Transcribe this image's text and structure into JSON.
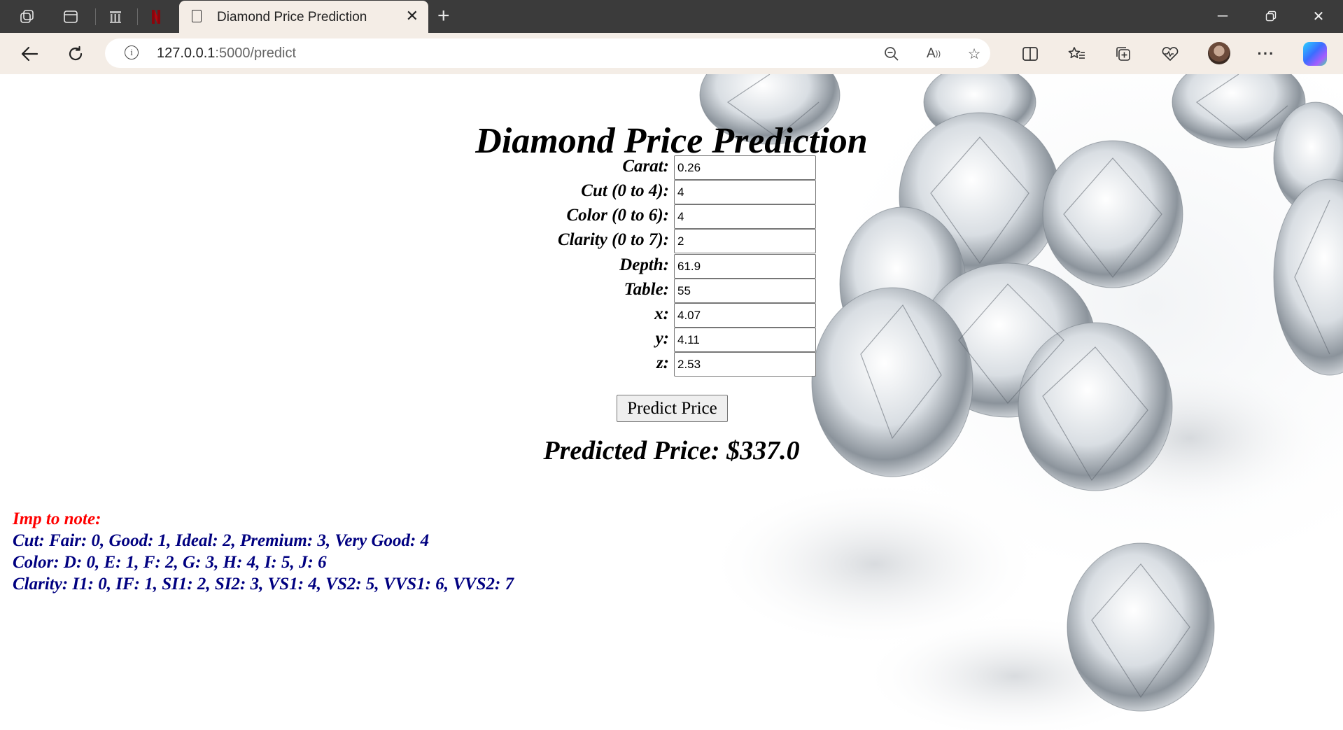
{
  "browser": {
    "tab_title": "Diamond Price Prediction",
    "url_host": "127.0.0.1",
    "url_rest": ":5000/predict",
    "new_tab_glyph": "+",
    "more_glyph": "···"
  },
  "page": {
    "title": "Diamond Price Prediction",
    "fields": [
      {
        "label": "Carat:",
        "value": "0.26"
      },
      {
        "label": "Cut (0 to 4):",
        "value": "4"
      },
      {
        "label": "Color (0 to 6):",
        "value": "4"
      },
      {
        "label": "Clarity (0 to 7):",
        "value": "2"
      },
      {
        "label": "Depth:",
        "value": "61.9"
      },
      {
        "label": "Table:",
        "value": "55"
      },
      {
        "label": "x:",
        "value": "4.07"
      },
      {
        "label": "y:",
        "value": "4.11"
      },
      {
        "label": "z:",
        "value": "2.53"
      }
    ],
    "predict_button": "Predict Price",
    "result": "Predicted Price: $337.0",
    "notes": {
      "heading": "Imp to note:",
      "cut": "Cut: Fair: 0, Good: 1, Ideal: 2, Premium: 3, Very Good: 4",
      "color": "Color: D: 0, E: 1, F: 2, G: 3, H: 4, I: 5, J: 6",
      "clarity": "Clarity: I1: 0, IF: 1, SI1: 2, SI2: 3, VS1: 4, VS2: 5, VVS1: 6, VVS2: 7"
    }
  },
  "icons": {
    "workspaces": "workspaces-icon",
    "tab_actions": "tab-actions-icon",
    "library": "library-icon",
    "netflix": "netflix-icon",
    "page": "page-icon",
    "back": "back-arrow-icon",
    "refresh": "refresh-icon",
    "info": "info-icon",
    "zoom": "zoom-out-icon",
    "read_aloud": "read-aloud-icon",
    "favorite": "star-icon",
    "split": "split-screen-icon",
    "favorites": "favorites-icon",
    "collections": "collections-icon",
    "health": "browser-essentials-icon",
    "profile": "avatar",
    "settings": "more-icon",
    "copilot": "copilot-icon"
  },
  "colors": {
    "note_heading": "#ff0000",
    "note_text": "#000080",
    "tabbar": "#3b3b3b",
    "toolbar": "#f4ede6"
  }
}
